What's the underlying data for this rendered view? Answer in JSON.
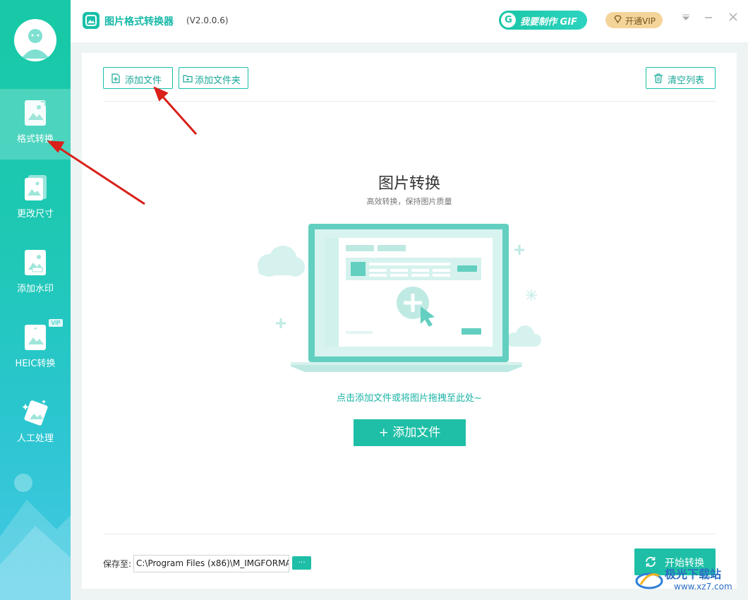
{
  "app": {
    "title": "图片格式转换器",
    "version": "(V2.0.0.6)"
  },
  "header": {
    "gif_button": "我要制作 GIF",
    "gif_icon": "G",
    "vip_button": "开通VIP"
  },
  "sidebar": {
    "items": [
      {
        "label": "格式转换",
        "icon": "format-convert-icon",
        "active": true
      },
      {
        "label": "更改尺寸",
        "icon": "resize-icon"
      },
      {
        "label": "添加水印",
        "icon": "watermark-icon"
      },
      {
        "label": "HEIC转换",
        "icon": "heic-icon",
        "badge": "VIP"
      },
      {
        "label": "人工处理",
        "icon": "manual-process-icon"
      }
    ]
  },
  "toolbar": {
    "add_file": "添加文件",
    "add_folder": "添加文件夹",
    "clear_list": "清空列表"
  },
  "main": {
    "heading": "图片转换",
    "subheading": "高效转换，保持图片质量",
    "hint": "点击添加文件或将图片拖拽至此处~",
    "add_button": "+ 添加文件"
  },
  "footer": {
    "save_label": "保存至:",
    "save_path": "C:\\Program Files (x86)\\M_IMGFORMA",
    "browse": "···",
    "start_button": "开始转换"
  },
  "watermark": {
    "text": "极光下载站",
    "url": "www.xz7.com"
  },
  "colors": {
    "accent": "#1ebfa6",
    "sidebar_top": "#17c9a6",
    "sidebar_bottom": "#45c8e6",
    "vip": "#f5d49a",
    "annotation_arrow": "#d9201a"
  }
}
